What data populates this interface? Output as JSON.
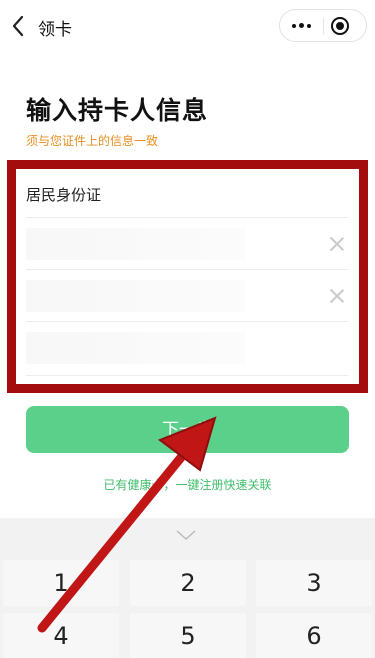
{
  "header": {
    "title": "领卡",
    "back_icon": "chevron-left-icon",
    "more_icon": "more-dots-icon",
    "close_icon": "target-circle-icon"
  },
  "main": {
    "heading": "输入持卡人信息",
    "hint": "须与您证件上的信息一致",
    "hint_color": "#e88f23",
    "fields": {
      "id_type": "居民身份证"
    },
    "next_button": "下一步",
    "link": "已有健康卡，一键注册快速关联"
  },
  "keypad": {
    "keys": [
      "1",
      "2",
      "3",
      "4",
      "5",
      "6"
    ]
  },
  "colors": {
    "accent": "#5bd08a",
    "highlight_box": "#a30d0d",
    "annotation_arrow": "#c01616"
  }
}
